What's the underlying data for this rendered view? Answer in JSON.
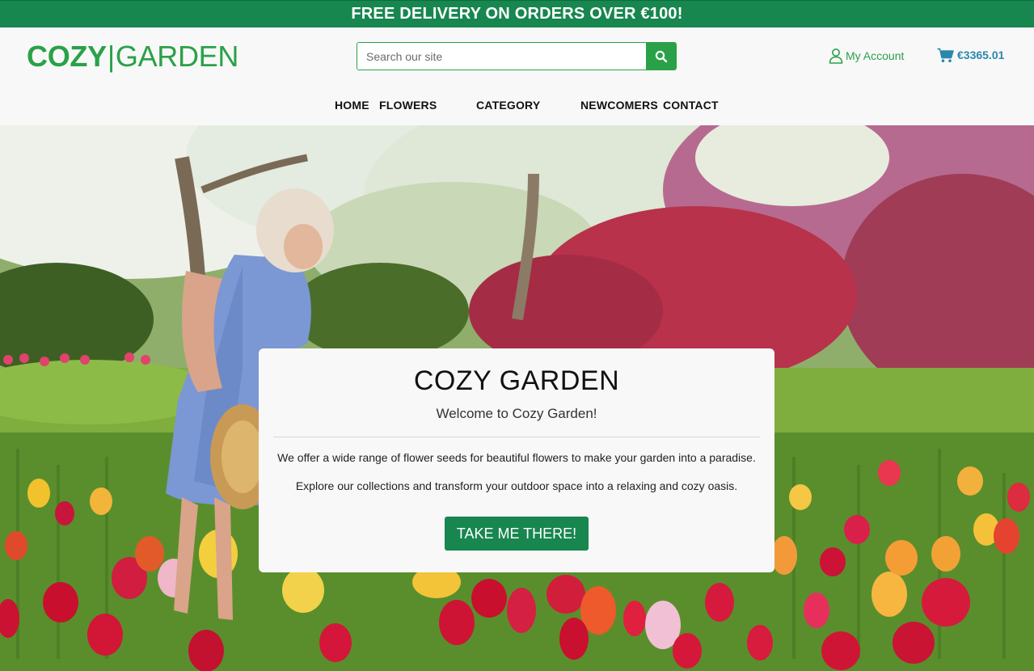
{
  "promo": {
    "text": "FREE DELIVERY ON ORDERS OVER €100!"
  },
  "header": {
    "logo_part1": "COZY",
    "logo_separator": "|",
    "logo_part2": "GARDEN",
    "search": {
      "placeholder": "Search our site",
      "value": ""
    },
    "account_label": "My Account",
    "cart_total": "€3365.01"
  },
  "nav": {
    "items": [
      {
        "label": "HOME"
      },
      {
        "label": "FLOWERS"
      },
      {
        "label": "CATEGORY"
      },
      {
        "label": "NEWCOMERS"
      },
      {
        "label": "CONTACT"
      }
    ]
  },
  "hero": {
    "title": "COZY GARDEN",
    "subtitle": "Welcome to Cozy Garden!",
    "paragraph1": "We offer a wide range of flower seeds for beautiful flowers to make your garden into a paradise.",
    "paragraph2": "Explore our collections and transform your outdoor space into a relaxing and cozy oasis.",
    "cta_label": "TAKE ME THERE!"
  },
  "colors": {
    "brand_green": "#2aa148",
    "banner_green": "#17864f",
    "cart_blue": "#2a87ad"
  },
  "icons": {
    "search": "search-icon",
    "account": "user-icon",
    "cart": "cart-icon"
  }
}
